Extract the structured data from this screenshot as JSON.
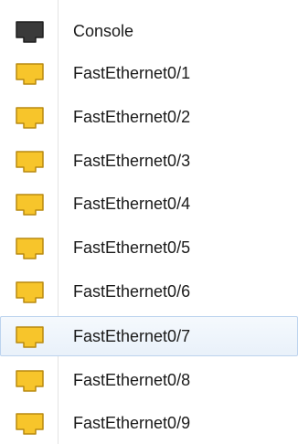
{
  "ports": [
    {
      "label": "Console",
      "icon": "console-port-icon",
      "color": "#3a3a3a",
      "selected": false
    },
    {
      "label": "FastEthernet0/1",
      "icon": "ethernet-port-icon",
      "color": "#f7c52b",
      "selected": false
    },
    {
      "label": "FastEthernet0/2",
      "icon": "ethernet-port-icon",
      "color": "#f7c52b",
      "selected": false
    },
    {
      "label": "FastEthernet0/3",
      "icon": "ethernet-port-icon",
      "color": "#f7c52b",
      "selected": false
    },
    {
      "label": "FastEthernet0/4",
      "icon": "ethernet-port-icon",
      "color": "#f7c52b",
      "selected": false
    },
    {
      "label": "FastEthernet0/5",
      "icon": "ethernet-port-icon",
      "color": "#f7c52b",
      "selected": false
    },
    {
      "label": "FastEthernet0/6",
      "icon": "ethernet-port-icon",
      "color": "#f7c52b",
      "selected": false
    },
    {
      "label": "FastEthernet0/7",
      "icon": "ethernet-port-icon",
      "color": "#f7c52b",
      "selected": true
    },
    {
      "label": "FastEthernet0/8",
      "icon": "ethernet-port-icon",
      "color": "#f7c52b",
      "selected": false
    },
    {
      "label": "FastEthernet0/9",
      "icon": "ethernet-port-icon",
      "color": "#f7c52b",
      "selected": false
    }
  ]
}
